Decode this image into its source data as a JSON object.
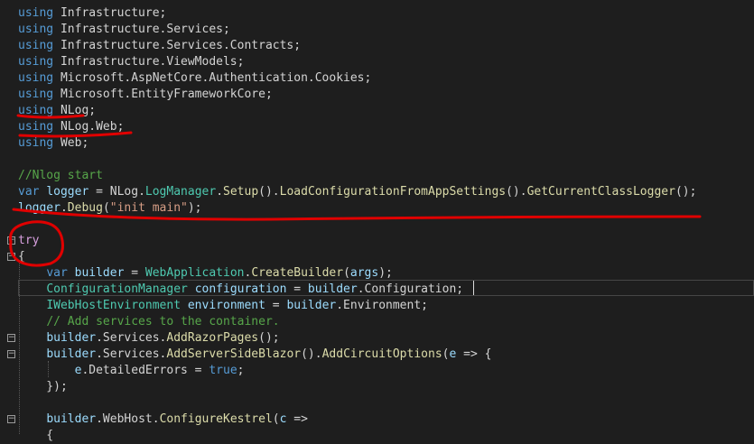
{
  "editor": {
    "lines": [
      [
        {
          "c": "kw",
          "t": "using"
        },
        {
          "c": "pl",
          "t": " Infrastructure;"
        }
      ],
      [
        {
          "c": "kw",
          "t": "using"
        },
        {
          "c": "pl",
          "t": " Infrastructure.Services;"
        }
      ],
      [
        {
          "c": "kw",
          "t": "using"
        },
        {
          "c": "pl",
          "t": " Infrastructure.Services.Contracts;"
        }
      ],
      [
        {
          "c": "kw",
          "t": "using"
        },
        {
          "c": "pl",
          "t": " Infrastructure.ViewModels;"
        }
      ],
      [
        {
          "c": "kw",
          "t": "using"
        },
        {
          "c": "pl",
          "t": " Microsoft.AspNetCore.Authentication.Cookies;"
        }
      ],
      [
        {
          "c": "kw",
          "t": "using"
        },
        {
          "c": "pl",
          "t": " Microsoft.EntityFrameworkCore;"
        }
      ],
      [
        {
          "c": "kw",
          "t": "using"
        },
        {
          "c": "pl",
          "t": " NLog;"
        }
      ],
      [
        {
          "c": "kw",
          "t": "using"
        },
        {
          "c": "pl",
          "t": " NLog.Web;"
        }
      ],
      [
        {
          "c": "kw",
          "t": "using"
        },
        {
          "c": "pl",
          "t": " Web;"
        }
      ],
      [],
      [
        {
          "c": "cm",
          "t": "//Nlog start"
        }
      ],
      [
        {
          "c": "kw",
          "t": "var"
        },
        {
          "c": "pl",
          "t": " "
        },
        {
          "c": "id",
          "t": "logger"
        },
        {
          "c": "pl",
          "t": " = NLog."
        },
        {
          "c": "ty",
          "t": "LogManager"
        },
        {
          "c": "pl",
          "t": "."
        },
        {
          "c": "fn",
          "t": "Setup"
        },
        {
          "c": "pl",
          "t": "()."
        },
        {
          "c": "fn",
          "t": "LoadConfigurationFromAppSettings"
        },
        {
          "c": "pl",
          "t": "()."
        },
        {
          "c": "fn",
          "t": "GetCurrentClassLogger"
        },
        {
          "c": "pl",
          "t": "();"
        }
      ],
      [
        {
          "c": "id",
          "t": "logger"
        },
        {
          "c": "pl",
          "t": "."
        },
        {
          "c": "fn",
          "t": "Debug"
        },
        {
          "c": "pl",
          "t": "("
        },
        {
          "c": "st",
          "t": "\"init main\""
        },
        {
          "c": "pl",
          "t": ");"
        }
      ],
      [],
      [
        {
          "c": "ctl",
          "t": "try"
        }
      ],
      [
        {
          "c": "pl",
          "t": "{"
        }
      ],
      [
        {
          "c": "pl",
          "t": "    "
        },
        {
          "c": "kw",
          "t": "var"
        },
        {
          "c": "pl",
          "t": " "
        },
        {
          "c": "id",
          "t": "builder"
        },
        {
          "c": "pl",
          "t": " = "
        },
        {
          "c": "ty",
          "t": "WebApplication"
        },
        {
          "c": "pl",
          "t": "."
        },
        {
          "c": "fn",
          "t": "CreateBuilder"
        },
        {
          "c": "pl",
          "t": "("
        },
        {
          "c": "id",
          "t": "args"
        },
        {
          "c": "pl",
          "t": ");"
        }
      ],
      [
        {
          "c": "pl",
          "t": "    "
        },
        {
          "c": "ty",
          "t": "ConfigurationManager"
        },
        {
          "c": "pl",
          "t": " "
        },
        {
          "c": "id",
          "t": "configuration"
        },
        {
          "c": "pl",
          "t": " = "
        },
        {
          "c": "id",
          "t": "builder"
        },
        {
          "c": "pl",
          "t": ".Configuration;"
        }
      ],
      [
        {
          "c": "pl",
          "t": "    "
        },
        {
          "c": "ty",
          "t": "IWebHostEnvironment"
        },
        {
          "c": "pl",
          "t": " "
        },
        {
          "c": "id",
          "t": "environment"
        },
        {
          "c": "pl",
          "t": " = "
        },
        {
          "c": "id",
          "t": "builder"
        },
        {
          "c": "pl",
          "t": ".Environment;"
        }
      ],
      [
        {
          "c": "pl",
          "t": "    "
        },
        {
          "c": "cm",
          "t": "// Add services to the container."
        }
      ],
      [
        {
          "c": "pl",
          "t": "    "
        },
        {
          "c": "id",
          "t": "builder"
        },
        {
          "c": "pl",
          "t": ".Services."
        },
        {
          "c": "fn",
          "t": "AddRazorPages"
        },
        {
          "c": "pl",
          "t": "();"
        }
      ],
      [
        {
          "c": "pl",
          "t": "    "
        },
        {
          "c": "id",
          "t": "builder"
        },
        {
          "c": "pl",
          "t": ".Services."
        },
        {
          "c": "fn",
          "t": "AddServerSideBlazor"
        },
        {
          "c": "pl",
          "t": "()."
        },
        {
          "c": "fn",
          "t": "AddCircuitOptions"
        },
        {
          "c": "pl",
          "t": "("
        },
        {
          "c": "id",
          "t": "e"
        },
        {
          "c": "pl",
          "t": " => {"
        }
      ],
      [
        {
          "c": "pl",
          "t": "        "
        },
        {
          "c": "id",
          "t": "e"
        },
        {
          "c": "pl",
          "t": ".DetailedErrors = "
        },
        {
          "c": "kw",
          "t": "true"
        },
        {
          "c": "pl",
          "t": ";"
        }
      ],
      [
        {
          "c": "pl",
          "t": "    });"
        }
      ],
      [],
      [
        {
          "c": "pl",
          "t": "    "
        },
        {
          "c": "id",
          "t": "builder"
        },
        {
          "c": "pl",
          "t": ".WebHost."
        },
        {
          "c": "fn",
          "t": "ConfigureKestrel"
        },
        {
          "c": "pl",
          "t": "("
        },
        {
          "c": "id",
          "t": "c"
        },
        {
          "c": "pl",
          "t": " =>"
        }
      ],
      [
        {
          "c": "pl",
          "t": "    {"
        }
      ]
    ],
    "fold_markers": [
      "−",
      "−",
      "−",
      "−",
      "−"
    ],
    "theme": {
      "background": "#1e1e1e",
      "keyword": "#569cd6",
      "type": "#4ec9b0",
      "method": "#dcdcaa",
      "variable": "#9cdcfe",
      "string": "#d69d85",
      "comment": "#57a64a",
      "annotation": "#e00000"
    }
  }
}
